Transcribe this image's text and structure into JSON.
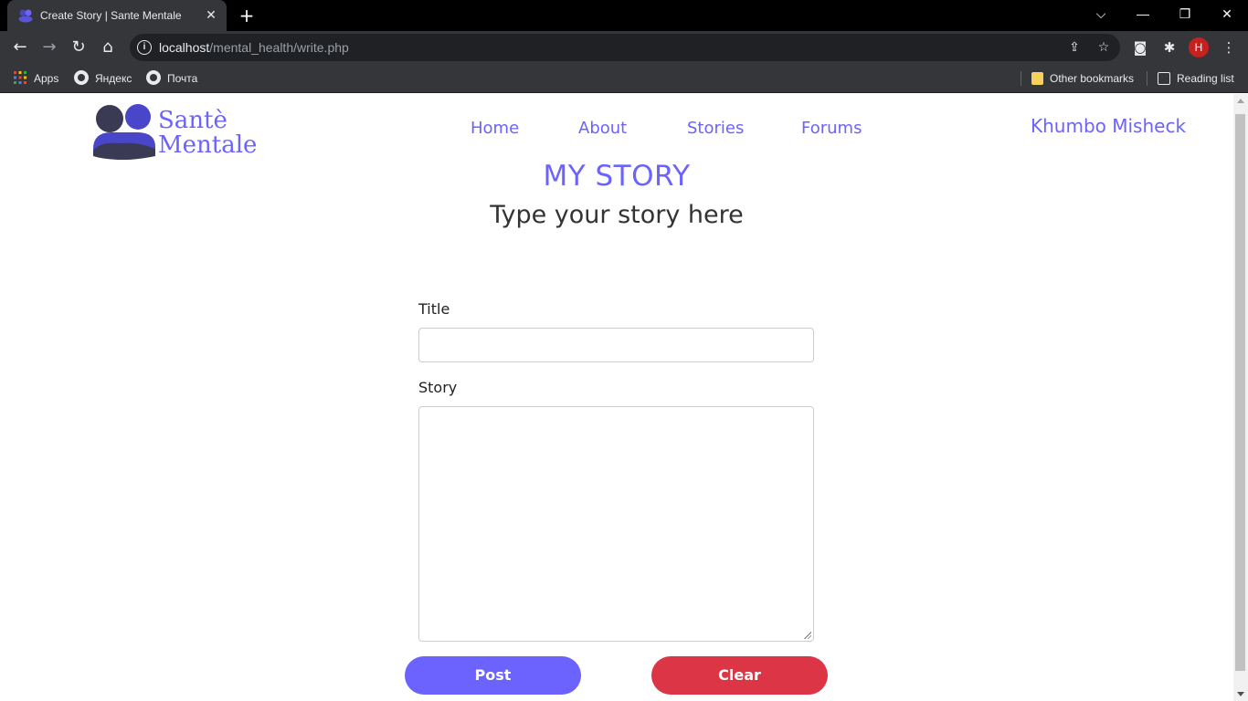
{
  "browser": {
    "tab_title": "Create Story | Sante Mentale",
    "url_host": "localhost",
    "url_path": "/mental_health/write.php",
    "profile_initial": "H",
    "bookmarks": [
      {
        "label": "Apps"
      },
      {
        "label": "Яндекс"
      },
      {
        "label": "Почта"
      }
    ],
    "other_bookmarks": "Other bookmarks",
    "reading_list": "Reading list"
  },
  "site": {
    "logo_line1": "Santè",
    "logo_line2": "Mentale",
    "nav": [
      {
        "label": "Home"
      },
      {
        "label": "About"
      },
      {
        "label": "Stories"
      },
      {
        "label": "Forums"
      }
    ],
    "user_name": "Khumbo Misheck",
    "accent_color": "#6c63ff",
    "danger_color": "#dc3545"
  },
  "form": {
    "heading": "MY STORY",
    "subheading": "Type your story here",
    "title_label": "Title",
    "title_value": "",
    "story_label": "Story",
    "story_value": "",
    "post_label": "Post",
    "clear_label": "Clear"
  }
}
